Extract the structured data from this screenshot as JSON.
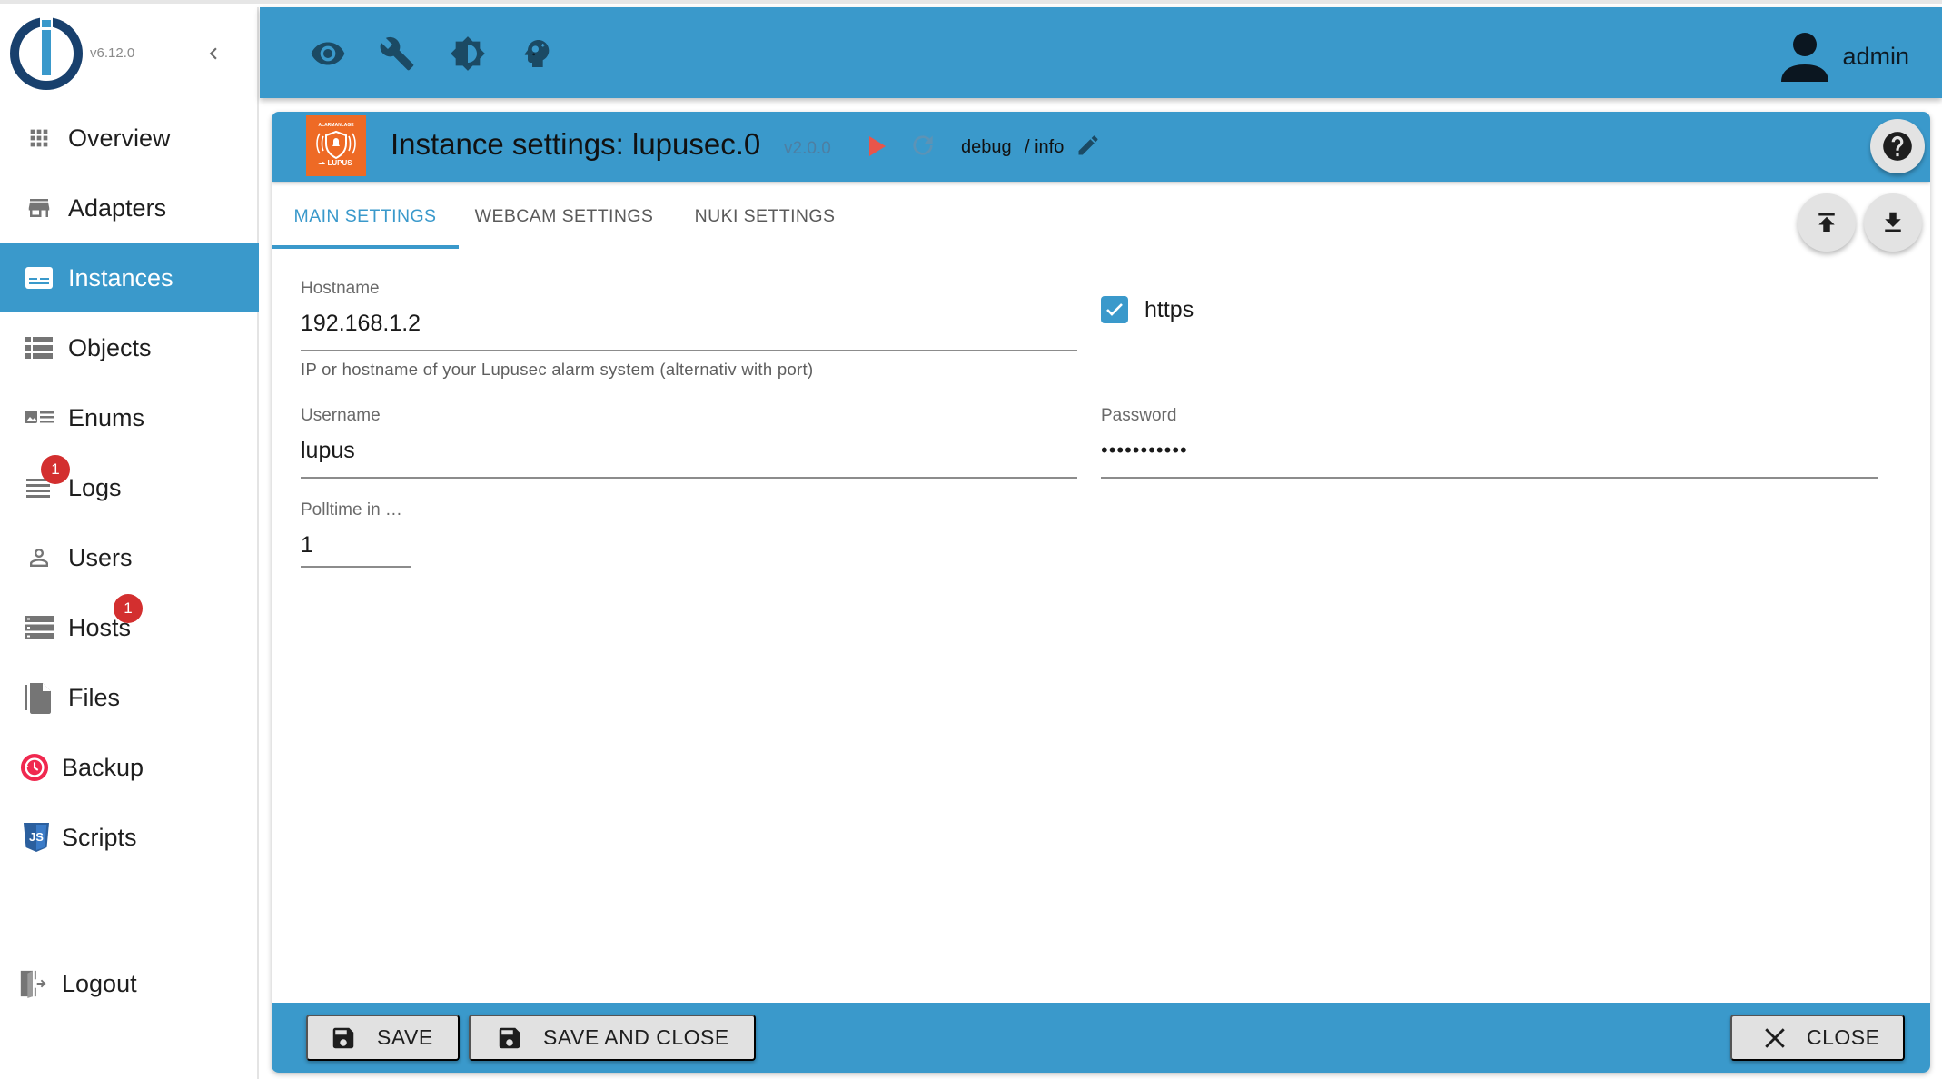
{
  "app": {
    "version": "v6.12.0"
  },
  "sidebar": {
    "items": [
      {
        "label": "Overview",
        "icon": "apps-grid-icon"
      },
      {
        "label": "Adapters",
        "icon": "store-icon"
      },
      {
        "label": "Instances",
        "icon": "instances-icon",
        "active": true
      },
      {
        "label": "Objects",
        "icon": "list-icon"
      },
      {
        "label": "Enums",
        "icon": "enum-icon"
      },
      {
        "label": "Logs",
        "icon": "logs-icon",
        "badge": "1"
      },
      {
        "label": "Users",
        "icon": "person-outline-icon"
      },
      {
        "label": "Hosts",
        "icon": "storage-icon",
        "badge": "1"
      },
      {
        "label": "Files",
        "icon": "files-icon"
      },
      {
        "label": "Backup",
        "icon": "backup-restore-icon"
      },
      {
        "label": "Scripts",
        "icon": "javascript-icon"
      }
    ],
    "logout_label": "Logout"
  },
  "appbar": {
    "icons": [
      "eye-icon",
      "wrench-icon",
      "brightness-icon",
      "expert-mode-icon"
    ],
    "user_name": "admin"
  },
  "instance": {
    "title": "Instance settings: lupusec.0",
    "version": "v2.0.0",
    "log_level": "debug",
    "log_level_sep": "/ info",
    "logo_text_top": "ALARMANLAGE",
    "logo_text_bottom": "LUPUS"
  },
  "tabs": [
    {
      "label": "MAIN SETTINGS",
      "active": true
    },
    {
      "label": "WEBCAM SETTINGS"
    },
    {
      "label": "NUKI SETTINGS"
    }
  ],
  "form": {
    "hostname": {
      "label": "Hostname",
      "value": "192.168.1.2",
      "help": "IP or hostname of your Lupusec alarm system (alternativ with port)"
    },
    "https": {
      "label": "https",
      "checked": true
    },
    "username": {
      "label": "Username",
      "value": "lupus"
    },
    "password": {
      "label": "Password",
      "value": "•••••••••••"
    },
    "polltime": {
      "label": "Polltime in …",
      "value": "1"
    }
  },
  "footer": {
    "save_label": "SAVE",
    "save_close_label": "SAVE AND CLOSE",
    "close_label": "CLOSE"
  },
  "colors": {
    "primary": "#3a99cb",
    "badge": "#d32f2f",
    "adapter_logo": "#ee6a25",
    "play": "#e8554a"
  }
}
